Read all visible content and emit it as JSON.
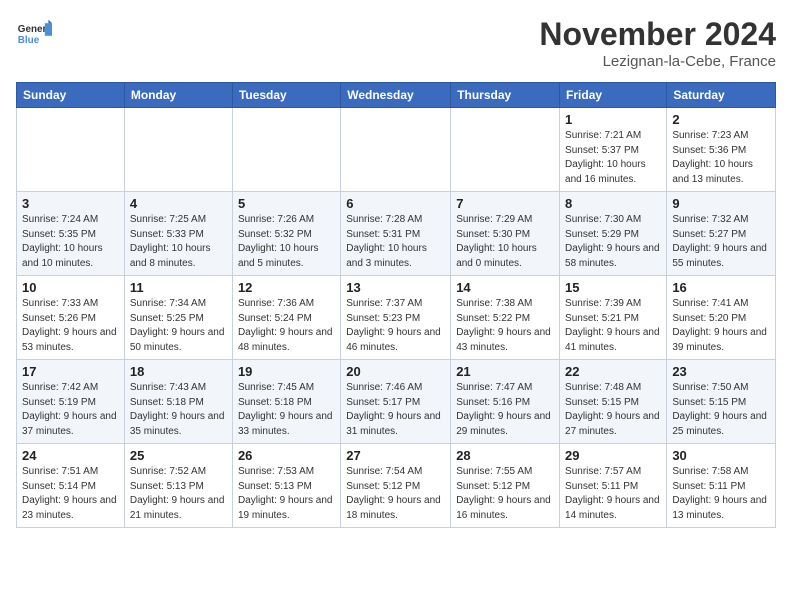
{
  "header": {
    "logo_general": "General",
    "logo_blue": "Blue",
    "month_title": "November 2024",
    "location": "Lezignan-la-Cebe, France"
  },
  "weekdays": [
    "Sunday",
    "Monday",
    "Tuesday",
    "Wednesday",
    "Thursday",
    "Friday",
    "Saturday"
  ],
  "weeks": [
    [
      {
        "day": "",
        "info": ""
      },
      {
        "day": "",
        "info": ""
      },
      {
        "day": "",
        "info": ""
      },
      {
        "day": "",
        "info": ""
      },
      {
        "day": "",
        "info": ""
      },
      {
        "day": "1",
        "info": "Sunrise: 7:21 AM\nSunset: 5:37 PM\nDaylight: 10 hours and 16 minutes."
      },
      {
        "day": "2",
        "info": "Sunrise: 7:23 AM\nSunset: 5:36 PM\nDaylight: 10 hours and 13 minutes."
      }
    ],
    [
      {
        "day": "3",
        "info": "Sunrise: 7:24 AM\nSunset: 5:35 PM\nDaylight: 10 hours and 10 minutes."
      },
      {
        "day": "4",
        "info": "Sunrise: 7:25 AM\nSunset: 5:33 PM\nDaylight: 10 hours and 8 minutes."
      },
      {
        "day": "5",
        "info": "Sunrise: 7:26 AM\nSunset: 5:32 PM\nDaylight: 10 hours and 5 minutes."
      },
      {
        "day": "6",
        "info": "Sunrise: 7:28 AM\nSunset: 5:31 PM\nDaylight: 10 hours and 3 minutes."
      },
      {
        "day": "7",
        "info": "Sunrise: 7:29 AM\nSunset: 5:30 PM\nDaylight: 10 hours and 0 minutes."
      },
      {
        "day": "8",
        "info": "Sunrise: 7:30 AM\nSunset: 5:29 PM\nDaylight: 9 hours and 58 minutes."
      },
      {
        "day": "9",
        "info": "Sunrise: 7:32 AM\nSunset: 5:27 PM\nDaylight: 9 hours and 55 minutes."
      }
    ],
    [
      {
        "day": "10",
        "info": "Sunrise: 7:33 AM\nSunset: 5:26 PM\nDaylight: 9 hours and 53 minutes."
      },
      {
        "day": "11",
        "info": "Sunrise: 7:34 AM\nSunset: 5:25 PM\nDaylight: 9 hours and 50 minutes."
      },
      {
        "day": "12",
        "info": "Sunrise: 7:36 AM\nSunset: 5:24 PM\nDaylight: 9 hours and 48 minutes."
      },
      {
        "day": "13",
        "info": "Sunrise: 7:37 AM\nSunset: 5:23 PM\nDaylight: 9 hours and 46 minutes."
      },
      {
        "day": "14",
        "info": "Sunrise: 7:38 AM\nSunset: 5:22 PM\nDaylight: 9 hours and 43 minutes."
      },
      {
        "day": "15",
        "info": "Sunrise: 7:39 AM\nSunset: 5:21 PM\nDaylight: 9 hours and 41 minutes."
      },
      {
        "day": "16",
        "info": "Sunrise: 7:41 AM\nSunset: 5:20 PM\nDaylight: 9 hours and 39 minutes."
      }
    ],
    [
      {
        "day": "17",
        "info": "Sunrise: 7:42 AM\nSunset: 5:19 PM\nDaylight: 9 hours and 37 minutes."
      },
      {
        "day": "18",
        "info": "Sunrise: 7:43 AM\nSunset: 5:18 PM\nDaylight: 9 hours and 35 minutes."
      },
      {
        "day": "19",
        "info": "Sunrise: 7:45 AM\nSunset: 5:18 PM\nDaylight: 9 hours and 33 minutes."
      },
      {
        "day": "20",
        "info": "Sunrise: 7:46 AM\nSunset: 5:17 PM\nDaylight: 9 hours and 31 minutes."
      },
      {
        "day": "21",
        "info": "Sunrise: 7:47 AM\nSunset: 5:16 PM\nDaylight: 9 hours and 29 minutes."
      },
      {
        "day": "22",
        "info": "Sunrise: 7:48 AM\nSunset: 5:15 PM\nDaylight: 9 hours and 27 minutes."
      },
      {
        "day": "23",
        "info": "Sunrise: 7:50 AM\nSunset: 5:15 PM\nDaylight: 9 hours and 25 minutes."
      }
    ],
    [
      {
        "day": "24",
        "info": "Sunrise: 7:51 AM\nSunset: 5:14 PM\nDaylight: 9 hours and 23 minutes."
      },
      {
        "day": "25",
        "info": "Sunrise: 7:52 AM\nSunset: 5:13 PM\nDaylight: 9 hours and 21 minutes."
      },
      {
        "day": "26",
        "info": "Sunrise: 7:53 AM\nSunset: 5:13 PM\nDaylight: 9 hours and 19 minutes."
      },
      {
        "day": "27",
        "info": "Sunrise: 7:54 AM\nSunset: 5:12 PM\nDaylight: 9 hours and 18 minutes."
      },
      {
        "day": "28",
        "info": "Sunrise: 7:55 AM\nSunset: 5:12 PM\nDaylight: 9 hours and 16 minutes."
      },
      {
        "day": "29",
        "info": "Sunrise: 7:57 AM\nSunset: 5:11 PM\nDaylight: 9 hours and 14 minutes."
      },
      {
        "day": "30",
        "info": "Sunrise: 7:58 AM\nSunset: 5:11 PM\nDaylight: 9 hours and 13 minutes."
      }
    ]
  ]
}
